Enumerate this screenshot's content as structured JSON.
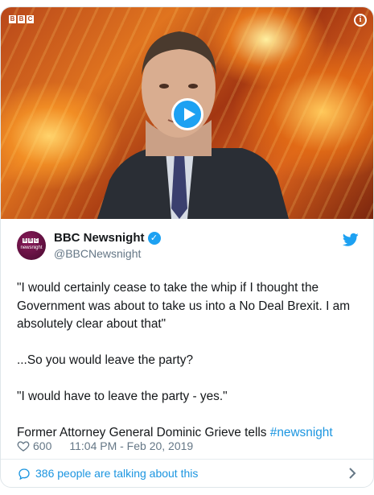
{
  "media": {
    "channel_logo": [
      "B",
      "B",
      "C"
    ],
    "info_icon": "info-icon",
    "play_icon": "play-icon"
  },
  "author": {
    "avatar_logo": [
      "B",
      "B",
      "C"
    ],
    "avatar_text": "newsnight",
    "display_name": "BBC Newsnight",
    "handle": "@BBCNewsnight",
    "verified_icon": "verified-badge-icon"
  },
  "tweet": {
    "paragraphs": [
      "\"I would certainly cease to take the whip if I thought the Government was about to take us into a No Deal Brexit. I am absolutely clear about that\"",
      "",
      "...So you would leave the party?",
      "",
      "\"I would have to leave the party - yes.\"",
      ""
    ],
    "last_line_text": "Former Attorney General Dominic Grieve tells ",
    "hashtag": "#newsnight"
  },
  "meta": {
    "like_count": "600",
    "timestamp": "11:04 PM - Feb 20, 2019"
  },
  "footer": {
    "talking_text": "386 people are talking about this"
  },
  "colors": {
    "accent": "#1da1f2",
    "link": "#1b95e0",
    "muted": "#657786",
    "text": "#14171a",
    "avatar_bg": "#5b0f3c"
  }
}
